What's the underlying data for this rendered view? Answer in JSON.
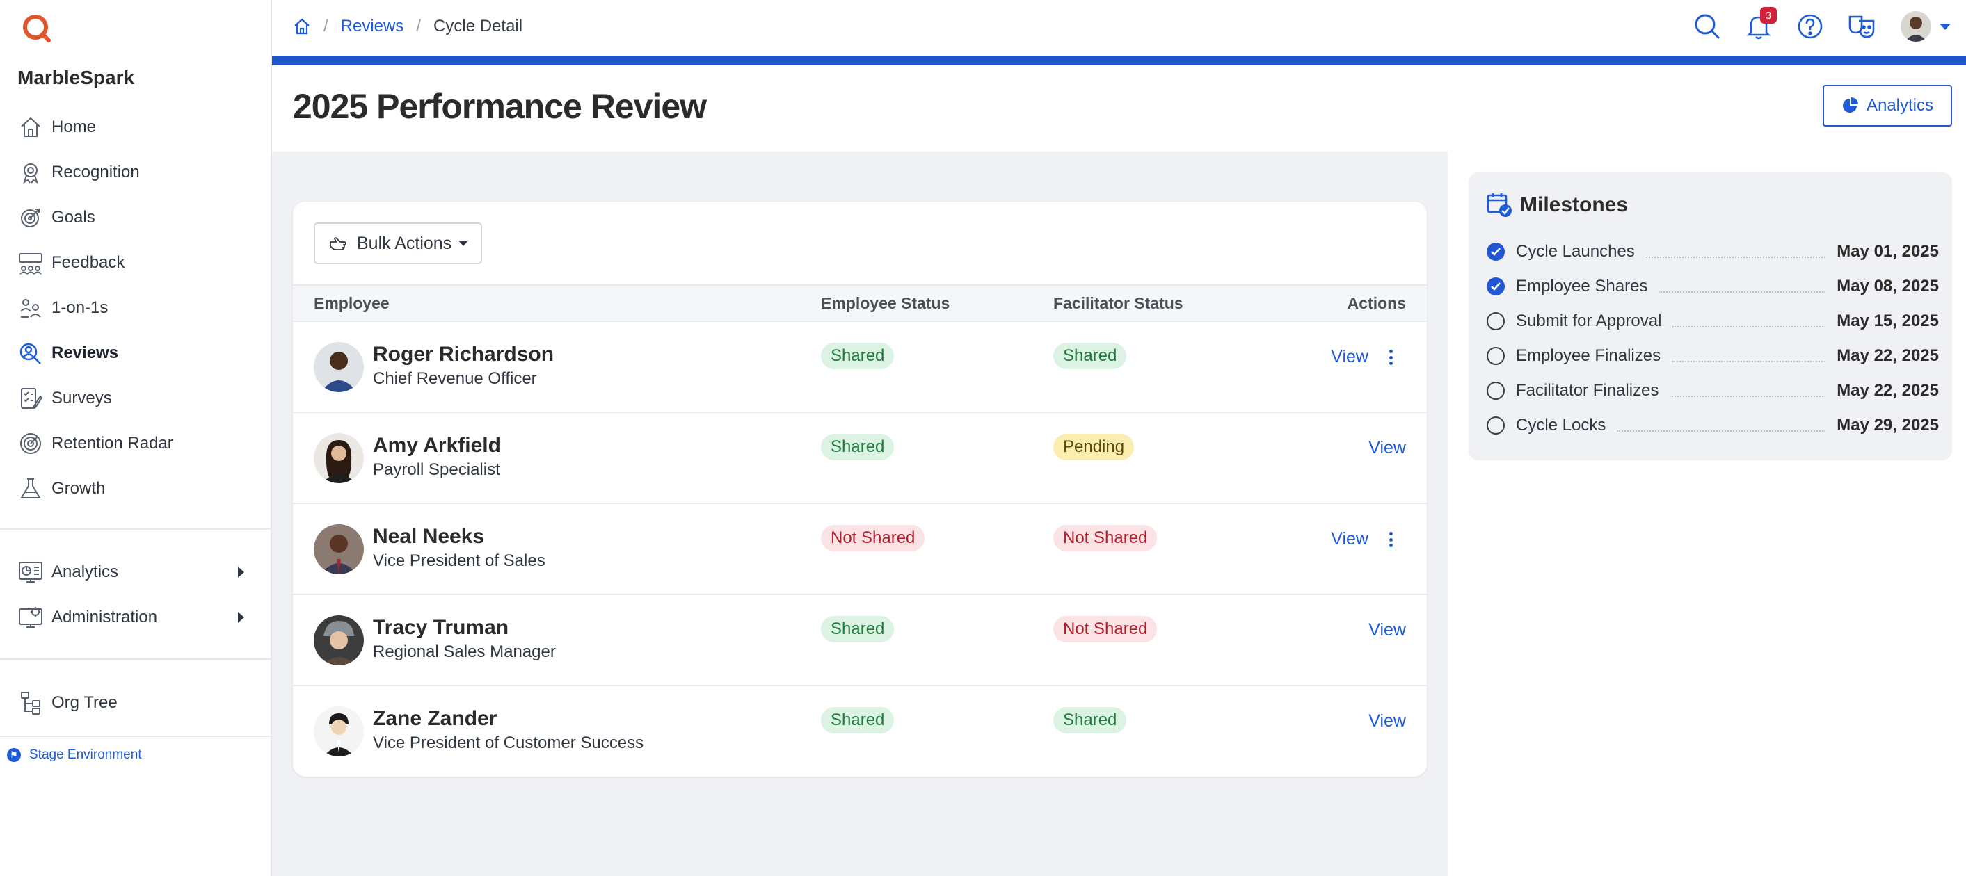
{
  "brand": "MarbleSpark",
  "sidebar": {
    "items": [
      {
        "label": "Home",
        "icon": "home-icon"
      },
      {
        "label": "Recognition",
        "icon": "award-icon"
      },
      {
        "label": "Goals",
        "icon": "target-icon"
      },
      {
        "label": "Feedback",
        "icon": "feedback-icon"
      },
      {
        "label": "1-on-1s",
        "icon": "one-on-one-icon"
      },
      {
        "label": "Reviews",
        "icon": "reviews-icon",
        "active": true
      },
      {
        "label": "Surveys",
        "icon": "survey-icon"
      },
      {
        "label": "Retention Radar",
        "icon": "radar-icon"
      },
      {
        "label": "Growth",
        "icon": "flask-icon"
      }
    ],
    "expandable": [
      {
        "label": "Analytics",
        "icon": "analytics-icon"
      },
      {
        "label": "Administration",
        "icon": "admin-icon"
      }
    ],
    "org_tree": "Org Tree",
    "environment": "Stage Environment"
  },
  "breadcrumb": {
    "reviews": "Reviews",
    "current": "Cycle Detail"
  },
  "header": {
    "notification_count": "3"
  },
  "page": {
    "title": "2025 Performance Review",
    "analytics_button": "Analytics"
  },
  "table": {
    "bulk_actions": "Bulk Actions",
    "columns": {
      "employee": "Employee",
      "employee_status": "Employee Status",
      "facilitator_status": "Facilitator Status",
      "actions": "Actions"
    },
    "rows": [
      {
        "name": "Roger Richardson",
        "title": "Chief Revenue Officer",
        "employee_status": "Shared",
        "facilitator_status": "Shared",
        "action": "View",
        "has_menu": true
      },
      {
        "name": "Amy Arkfield",
        "title": "Payroll Specialist",
        "employee_status": "Shared",
        "facilitator_status": "Pending",
        "action": "View",
        "has_menu": false
      },
      {
        "name": "Neal Neeks",
        "title": "Vice President of Sales",
        "employee_status": "Not Shared",
        "facilitator_status": "Not Shared",
        "action": "View",
        "has_menu": true
      },
      {
        "name": "Tracy Truman",
        "title": "Regional Sales Manager",
        "employee_status": "Shared",
        "facilitator_status": "Not Shared",
        "action": "View",
        "has_menu": false
      },
      {
        "name": "Zane Zander",
        "title": "Vice President of Customer Success",
        "employee_status": "Shared",
        "facilitator_status": "Shared",
        "action": "View",
        "has_menu": false
      }
    ]
  },
  "milestones": {
    "title": "Milestones",
    "items": [
      {
        "label": "Cycle Launches",
        "date": "May 01, 2025",
        "done": true
      },
      {
        "label": "Employee Shares",
        "date": "May 08, 2025",
        "done": true
      },
      {
        "label": "Submit for Approval",
        "date": "May 15, 2025",
        "done": false
      },
      {
        "label": "Employee Finalizes",
        "date": "May 22, 2025",
        "done": false
      },
      {
        "label": "Facilitator Finalizes",
        "date": "May 22, 2025",
        "done": false
      },
      {
        "label": "Cycle Locks",
        "date": "May 29, 2025",
        "done": false
      }
    ]
  },
  "colors": {
    "accent": "#1e5bd6",
    "header_bar": "#1f55c8",
    "shared_bg": "#dcf3e3",
    "pending_bg": "#fbecb0",
    "not_shared_bg": "#fbe2e4"
  }
}
